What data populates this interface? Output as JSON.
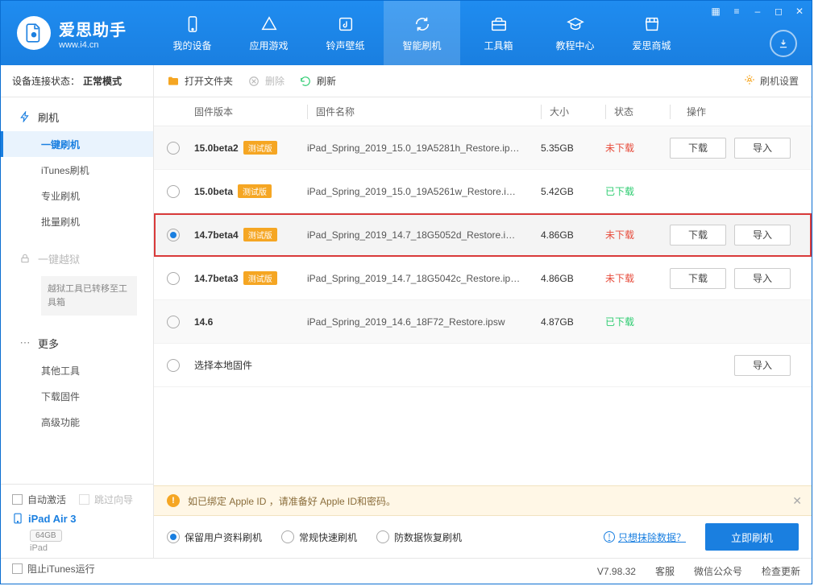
{
  "brand": {
    "name": "爱思助手",
    "site": "www.i4.cn"
  },
  "win_icons": {
    "grid": "▦",
    "help": "≡",
    "min": "–",
    "max": "◻",
    "close": "✕"
  },
  "nav": [
    {
      "icon": "phone",
      "label": "我的设备"
    },
    {
      "icon": "apps",
      "label": "应用游戏"
    },
    {
      "icon": "music",
      "label": "铃声壁纸"
    },
    {
      "icon": "refresh",
      "label": "智能刷机",
      "active": true
    },
    {
      "icon": "toolbox",
      "label": "工具箱"
    },
    {
      "icon": "grad",
      "label": "教程中心"
    },
    {
      "icon": "shop",
      "label": "爱思商城"
    }
  ],
  "sidebar": {
    "status_label": "设备连接状态：",
    "status_value": "正常模式",
    "sections": {
      "flash_head": "刷机",
      "flash_items": [
        "一键刷机",
        "iTunes刷机",
        "专业刷机",
        "批量刷机"
      ],
      "jb_head": "一键越狱",
      "jb_note": "越狱工具已转移至工具箱",
      "more_head": "更多",
      "more_items": [
        "其他工具",
        "下载固件",
        "高级功能"
      ]
    },
    "auto_activate": "自动激活",
    "skip_guide": "跳过向导",
    "device_name": "iPad Air 3",
    "device_cap": "64GB",
    "device_sub": "iPad"
  },
  "toolbar": {
    "open_folder": "打开文件夹",
    "delete": "删除",
    "refresh": "刷新",
    "settings": "刷机设置"
  },
  "columns": {
    "version": "固件版本",
    "name": "固件名称",
    "size": "大小",
    "status": "状态",
    "action": "操作"
  },
  "statuses": {
    "not_downloaded": "未下载",
    "downloaded": "已下载"
  },
  "actions": {
    "download": "下载",
    "import": "导入"
  },
  "beta_pill": "测试版",
  "rows": [
    {
      "version": "15.0beta2",
      "beta": true,
      "name": "iPad_Spring_2019_15.0_19A5281h_Restore.ip…",
      "size": "5.35GB",
      "status": "not_downloaded",
      "selected": false,
      "alt": true,
      "show_actions": true
    },
    {
      "version": "15.0beta",
      "beta": true,
      "name": "iPad_Spring_2019_15.0_19A5261w_Restore.i…",
      "size": "5.42GB",
      "status": "downloaded",
      "selected": false,
      "alt": false,
      "show_actions": false
    },
    {
      "version": "14.7beta4",
      "beta": true,
      "name": "iPad_Spring_2019_14.7_18G5052d_Restore.i…",
      "size": "4.86GB",
      "status": "not_downloaded",
      "selected": true,
      "alt": true,
      "show_actions": true
    },
    {
      "version": "14.7beta3",
      "beta": true,
      "name": "iPad_Spring_2019_14.7_18G5042c_Restore.ip…",
      "size": "4.86GB",
      "status": "not_downloaded",
      "selected": false,
      "alt": false,
      "show_actions": true
    },
    {
      "version": "14.6",
      "beta": false,
      "name": "iPad_Spring_2019_14.6_18F72_Restore.ipsw",
      "size": "4.87GB",
      "status": "downloaded",
      "selected": false,
      "alt": true,
      "show_actions": false
    }
  ],
  "local_row_label": "选择本地固件",
  "banner": "如已绑定 Apple ID ，请准备好 Apple ID和密码。",
  "flash_options": {
    "keep_data": "保留用户资料刷机",
    "normal": "常规快速刷机",
    "anti_recovery": "防数据恢复刷机",
    "erase_link": "只想抹除数据？",
    "flash_now": "立即刷机"
  },
  "footer": {
    "block_itunes": "阻止iTunes运行",
    "version": "V7.98.32",
    "support": "客服",
    "wechat": "微信公众号",
    "check_update": "检查更新"
  }
}
